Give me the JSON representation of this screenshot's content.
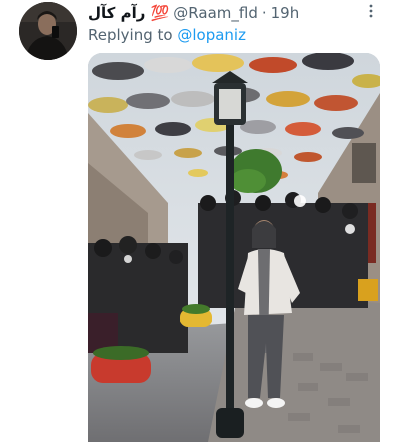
{
  "tweet": {
    "display_name": "رآم کآل",
    "display_name_emoji": "💯",
    "handle": "@Raam_fld",
    "time": "19h",
    "replying_prefix": "Replying to",
    "replying_handle": "@lopaniz"
  },
  "icons": {
    "more": "more-vertical-icon"
  },
  "media": {
    "description_name": "tweet-photo"
  }
}
